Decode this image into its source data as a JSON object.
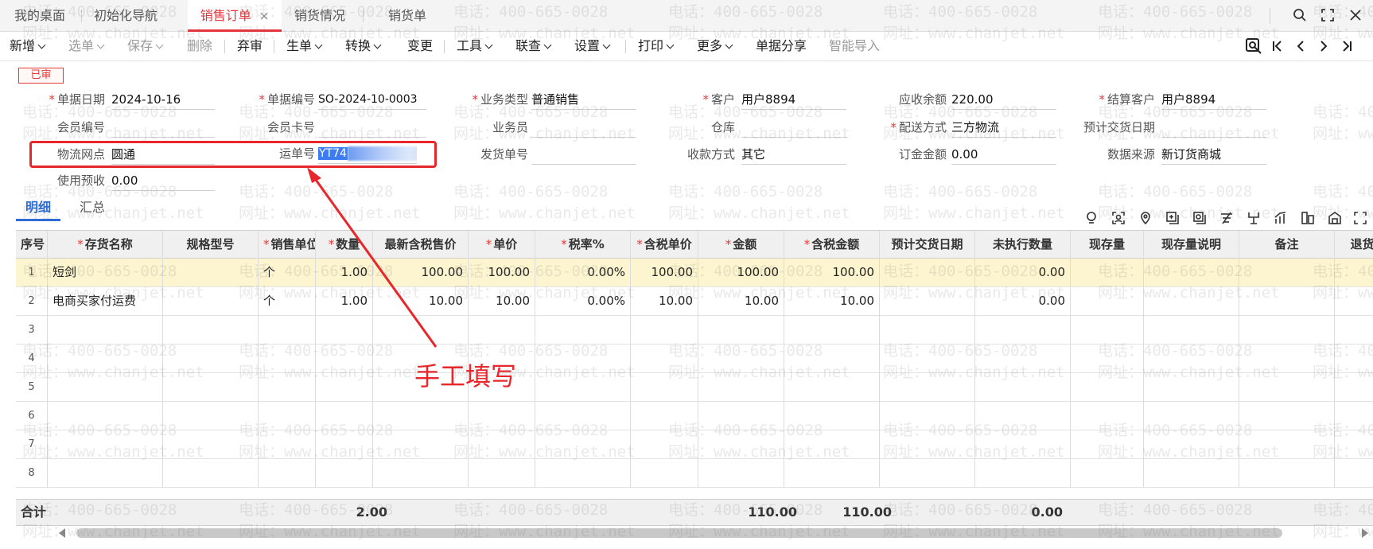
{
  "tabs": [
    {
      "label": "我的桌面"
    },
    {
      "label": "初始化导航"
    },
    {
      "label": "销售订单",
      "close": "×"
    },
    {
      "label": "销货情况"
    },
    {
      "label": "销货单"
    }
  ],
  "window_icons": [
    "search-icon",
    "fullscreen-icon",
    "close-icon"
  ],
  "toolbar": {
    "items": [
      {
        "label": "新增",
        "dropdown": true
      },
      {
        "label": "选单",
        "dropdown": true,
        "disabled": true
      },
      {
        "label": "保存",
        "dropdown": true,
        "disabled": true
      },
      {
        "label": "删除",
        "disabled": true
      },
      {
        "label": "弃审"
      },
      {
        "label": "生单",
        "dropdown": true
      },
      {
        "label": "转换",
        "dropdown": true
      },
      {
        "label": "变更"
      },
      {
        "label": "工具",
        "dropdown": true
      },
      {
        "label": "联查",
        "dropdown": true
      },
      {
        "label": "设置",
        "dropdown": true
      },
      {
        "label": "打印",
        "dropdown": true
      },
      {
        "label": "更多",
        "dropdown": true
      },
      {
        "label": "单据分享"
      },
      {
        "label": "智能导入",
        "disabled": true
      }
    ],
    "nav_icons": [
      "search-record-icon",
      "first-record-icon",
      "prev-record-icon",
      "next-record-icon",
      "last-record-icon"
    ]
  },
  "status_badge": "已审",
  "form": {
    "doc_date": {
      "label": "单据日期",
      "value": "2024-10-16"
    },
    "doc_no": {
      "label": "单据编号",
      "value": "SO-2024-10-0003"
    },
    "biz_type": {
      "label": "业务类型",
      "value": "普通销售"
    },
    "customer": {
      "label": "客户",
      "value": "用户8894"
    },
    "receivable": {
      "label": "应收余额",
      "value": "220.00"
    },
    "settle_customer": {
      "label": "结算客户",
      "value": "用户8894"
    },
    "member_no": {
      "label": "会员编号",
      "value": ""
    },
    "member_card": {
      "label": "会员卡号",
      "value": ""
    },
    "salesman": {
      "label": "业务员",
      "value": ""
    },
    "warehouse": {
      "label": "仓库",
      "value": ""
    },
    "delivery": {
      "label": "配送方式",
      "value": "三方物流"
    },
    "est_date": {
      "label": "预计交货日期",
      "value": ""
    },
    "logistics": {
      "label": "物流网点",
      "value": "圆通"
    },
    "waybill": {
      "label": "运单号",
      "value": "YT74"
    },
    "ship_no": {
      "label": "发货单号",
      "value": ""
    },
    "payment": {
      "label": "收款方式",
      "value": "其它"
    },
    "deposit": {
      "label": "订金金额",
      "value": "0.00"
    },
    "source": {
      "label": "数据来源",
      "value": "新订货商城"
    },
    "prepay": {
      "label": "使用预收",
      "value": "0.00"
    }
  },
  "subtabs": [
    "明细",
    "汇总"
  ],
  "grid_tool_icons": [
    "bulb-icon",
    "scan-icon",
    "location-icon",
    "add-row-icon",
    "settings-row-icon",
    "filter-icon",
    "split-icon",
    "chart-icon",
    "column-icon",
    "warehouse-icon",
    "expand-icon"
  ],
  "table": {
    "columns": [
      {
        "label": "序号",
        "req": false
      },
      {
        "label": "存货名称",
        "req": true
      },
      {
        "label": "规格型号",
        "req": false
      },
      {
        "label": "销售单位",
        "req": true
      },
      {
        "label": "数量",
        "req": true
      },
      {
        "label": "最新含税售价",
        "req": false
      },
      {
        "label": "单价",
        "req": true
      },
      {
        "label": "税率%",
        "req": true
      },
      {
        "label": "含税单价",
        "req": true
      },
      {
        "label": "金额",
        "req": true
      },
      {
        "label": "含税金额",
        "req": true
      },
      {
        "label": "预计交货日期",
        "req": false
      },
      {
        "label": "未执行数量",
        "req": false
      },
      {
        "label": "现存量",
        "req": false
      },
      {
        "label": "现存量说明",
        "req": false
      },
      {
        "label": "备注",
        "req": false
      },
      {
        "label": "退货",
        "req": false
      }
    ],
    "rows": [
      [
        "1",
        "短剑",
        "",
        "个",
        "1.00",
        "100.00",
        "100.00",
        "0.00%",
        "100.00",
        "100.00",
        "100.00",
        "",
        "0.00",
        "",
        "",
        "",
        ""
      ],
      [
        "2",
        "电商买家付运费",
        "",
        "个",
        "1.00",
        "10.00",
        "10.00",
        "0.00%",
        "10.00",
        "10.00",
        "10.00",
        "",
        "0.00",
        "",
        "",
        "",
        ""
      ],
      [
        "3",
        "",
        "",
        "",
        "",
        "",
        "",
        "",
        "",
        "",
        "",
        "",
        "",
        "",
        "",
        "",
        ""
      ],
      [
        "4",
        "",
        "",
        "",
        "",
        "",
        "",
        "",
        "",
        "",
        "",
        "",
        "",
        "",
        "",
        "",
        ""
      ],
      [
        "5",
        "",
        "",
        "",
        "",
        "",
        "",
        "",
        "",
        "",
        "",
        "",
        "",
        "",
        "",
        "",
        ""
      ],
      [
        "6",
        "",
        "",
        "",
        "",
        "",
        "",
        "",
        "",
        "",
        "",
        "",
        "",
        "",
        "",
        "",
        ""
      ],
      [
        "7",
        "",
        "",
        "",
        "",
        "",
        "",
        "",
        "",
        "",
        "",
        "",
        "",
        "",
        "",
        "",
        ""
      ],
      [
        "8",
        "",
        "",
        "",
        "",
        "",
        "",
        "",
        "",
        "",
        "",
        "",
        "",
        "",
        "",
        "",
        ""
      ]
    ],
    "total": {
      "label": "合计",
      "qty": "2.00",
      "amount": "110.00",
      "tax_amount": "110.00",
      "unexec": "0.00"
    }
  },
  "annotation": "手工填写",
  "watermark": {
    "line1": "电话：400-665-0028",
    "line2": "网址：www.chanjet.net"
  },
  "colors": {
    "accent": "#e8343c",
    "link": "#2d6bd6",
    "selected_row": "#fdf5cf"
  }
}
